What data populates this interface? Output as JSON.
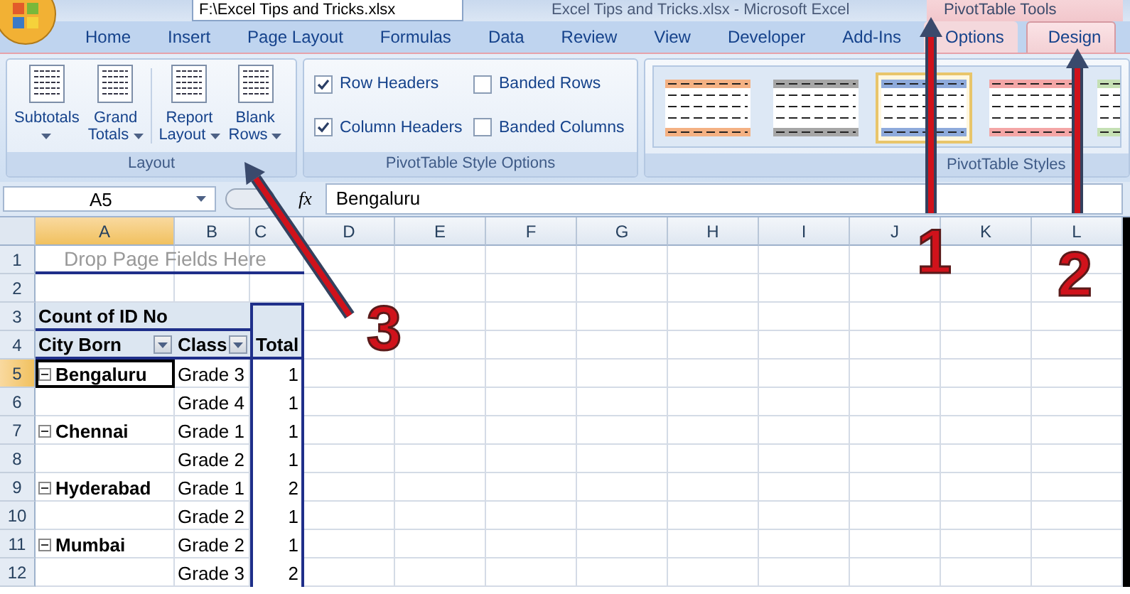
{
  "window": {
    "file_path": "F:\\Excel Tips and Tricks.xlsx",
    "title": "Excel Tips and Tricks.xlsx - Microsoft Excel",
    "context_label": "PivotTable Tools"
  },
  "tabs": [
    {
      "label": "Home",
      "selected": false,
      "kind": "main"
    },
    {
      "label": "Insert",
      "selected": false,
      "kind": "main"
    },
    {
      "label": "Page Layout",
      "selected": false,
      "kind": "main"
    },
    {
      "label": "Formulas",
      "selected": false,
      "kind": "main"
    },
    {
      "label": "Data",
      "selected": false,
      "kind": "main"
    },
    {
      "label": "Review",
      "selected": false,
      "kind": "main"
    },
    {
      "label": "View",
      "selected": false,
      "kind": "main"
    },
    {
      "label": "Developer",
      "selected": false,
      "kind": "main"
    },
    {
      "label": "Add-Ins",
      "selected": false,
      "kind": "main"
    },
    {
      "label": "Options",
      "selected": false,
      "kind": "context"
    },
    {
      "label": "Design",
      "selected": true,
      "kind": "context"
    }
  ],
  "ribbon": {
    "groups": [
      {
        "label": "Layout",
        "kind": "buttons",
        "buttons": [
          {
            "lines": [
              "Subtotals"
            ]
          },
          {
            "lines": [
              "Grand",
              "Totals"
            ]
          },
          {
            "lines": [
              "Report",
              "Layout"
            ]
          },
          {
            "lines": [
              "Blank",
              "Rows"
            ]
          }
        ]
      },
      {
        "label": "PivotTable Style Options",
        "kind": "checkboxes",
        "checkboxes": [
          {
            "label": "Row Headers",
            "checked": true
          },
          {
            "label": "Banded Rows",
            "checked": false
          },
          {
            "label": "Column Headers",
            "checked": true
          },
          {
            "label": "Banded Columns",
            "checked": false
          }
        ]
      },
      {
        "label": "PivotTable Styles",
        "kind": "gallery",
        "styles": [
          {
            "color": "#f4b183",
            "selected": false
          },
          {
            "color": "#a6a6a6",
            "selected": false
          },
          {
            "color": "#8eaadb",
            "selected": true
          },
          {
            "color": "#f4a6a6",
            "selected": false
          },
          {
            "color": "#c5e0b4",
            "selected": false
          }
        ]
      }
    ]
  },
  "formula_bar": {
    "name_box": "A5",
    "function_button": "fx",
    "formula": "Bengaluru"
  },
  "grid": {
    "columns": [
      {
        "label": "A",
        "selected": true
      },
      {
        "label": "B",
        "selected": false
      },
      {
        "label": "C",
        "selected": false
      },
      {
        "label": "D",
        "selected": false
      },
      {
        "label": "E",
        "selected": false
      },
      {
        "label": "F",
        "selected": false
      },
      {
        "label": "G",
        "selected": false
      },
      {
        "label": "H",
        "selected": false
      },
      {
        "label": "I",
        "selected": false
      },
      {
        "label": "J",
        "selected": false
      },
      {
        "label": "K",
        "selected": false
      },
      {
        "label": "L",
        "selected": false
      }
    ],
    "row_numbers": [
      {
        "label": "1",
        "selected": false
      },
      {
        "label": "2",
        "selected": false
      },
      {
        "label": "3",
        "selected": false
      },
      {
        "label": "4",
        "selected": false
      },
      {
        "label": "5",
        "selected": true
      },
      {
        "label": "6",
        "selected": false
      },
      {
        "label": "7",
        "selected": false
      },
      {
        "label": "8",
        "selected": false
      },
      {
        "label": "9",
        "selected": false
      },
      {
        "label": "10",
        "selected": false
      },
      {
        "label": "11",
        "selected": false
      },
      {
        "label": "12",
        "selected": false
      }
    ]
  },
  "pivot": {
    "page_fields_hint": "Drop Page Fields Here",
    "value_label": "Count of ID No",
    "headers": [
      {
        "label": "City Born",
        "filter": true
      },
      {
        "label": "Class",
        "filter": true
      },
      {
        "label": "Total",
        "filter": false
      }
    ],
    "rows": [
      {
        "city": "Bengaluru",
        "class": "Grade 3",
        "total": "1",
        "selected": true
      },
      {
        "class": "Grade 4",
        "total": "1",
        "selected": false
      },
      {
        "city": "Chennai",
        "class": "Grade 1",
        "total": "1",
        "selected": false
      },
      {
        "class": "Grade 2",
        "total": "1",
        "selected": false
      },
      {
        "city": "Hyderabad",
        "class": "Grade 1",
        "total": "2",
        "selected": false
      },
      {
        "class": "Grade 2",
        "total": "1",
        "selected": false
      },
      {
        "city": "Mumbai",
        "class": "Grade 2",
        "total": "1",
        "selected": false
      },
      {
        "class": "Grade 3",
        "total": "2",
        "selected": false
      }
    ]
  },
  "annotations": [
    {
      "number": "1"
    },
    {
      "number": "2"
    },
    {
      "number": "3"
    }
  ]
}
